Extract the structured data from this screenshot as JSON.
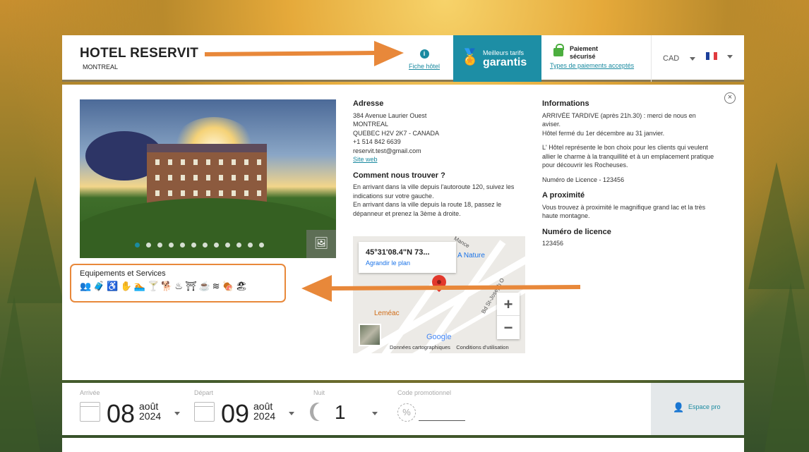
{
  "header": {
    "hotel_name": "HOTEL RESERVIT",
    "city": "MONTREAL",
    "fiche_label": "Fiche hôtel",
    "best_rates_line1": "Meilleurs tarifs",
    "best_rates_line2": "garantis",
    "secure_line1": "Paiement",
    "secure_line2": "sécurisé",
    "payment_types_link": "Types de paiements acceptés",
    "currency": "CAD",
    "language_flag": "fr",
    "colors": {
      "accent": "#1d8ea5",
      "secure": "#4cae3f",
      "arrow": "#e8883a"
    }
  },
  "address": {
    "title": "Adresse",
    "street": "384 Avenue Laurier Ouest",
    "city": "MONTREAL",
    "region": "QUEBEC H2V 2K7 - CANADA",
    "phone": "+1 514 842 6639",
    "email": "reservit.test@gmail.com",
    "website": "Site web"
  },
  "directions": {
    "title": "Comment nous trouver ?",
    "text1": "En arrivant dans la ville depuis l'autoroute 120, suivez les indications sur votre gauche.",
    "text2": "En arrivant dans la ville depuis la route 18, passez le dépanneur et prenez la 3ème à droite."
  },
  "map": {
    "coords": "45°31'08.4\"N 73...",
    "enlarge": "Agrandir le plan",
    "place1": "A Nature",
    "place2": "Leméac",
    "street1": "Bd St-Joseph O",
    "street2": "Mance",
    "google": "Google",
    "map_data": "Données cartographiques",
    "terms": "Conditions d'utilisation",
    "zoom_in": "+",
    "zoom_out": "−"
  },
  "info": {
    "title": "Informations",
    "late_arrival": "ARRIVÉE TARDIVE (après 21h.30) : merci de nous en aviser.",
    "closed": "Hôtel fermé du 1er décembre au 31 janvier.",
    "description": "L' Hôtel représente le bon choix pour les clients qui veulent allier le charme à la tranquillité et à un emplacement pratique pour découvrir les Rocheuses.",
    "license_line": "Numéro de Licence - 123456",
    "nearby_title": "A proximité",
    "nearby_text": "Vous trouvez à proximité le magnifique grand lac et la très haute montagne.",
    "license_title": "Numéro de licence",
    "license_number": "123456"
  },
  "equipment": {
    "title": "Equipements et Services",
    "icons": [
      "group-icon",
      "luggage-icon",
      "wheelchair-icon",
      "hand-icon",
      "swimming-icon",
      "cocktail-icon",
      "pet-icon",
      "sauna-icon",
      "iron-icon",
      "coffee-icon",
      "spa-icon",
      "bbq-icon",
      "beach-icon"
    ]
  },
  "booking": {
    "arrival_label": "Arrivée",
    "arrival_day": "08",
    "arrival_month": "août",
    "arrival_year": "2024",
    "departure_label": "Départ",
    "departure_day": "09",
    "departure_month": "août",
    "departure_year": "2024",
    "night_label": "Nuit",
    "nights": "1",
    "promo_label": "Code promotionnel",
    "pro_label": "Espace pro"
  },
  "gallery": {
    "slide_count": 12,
    "active_slide": 1
  }
}
